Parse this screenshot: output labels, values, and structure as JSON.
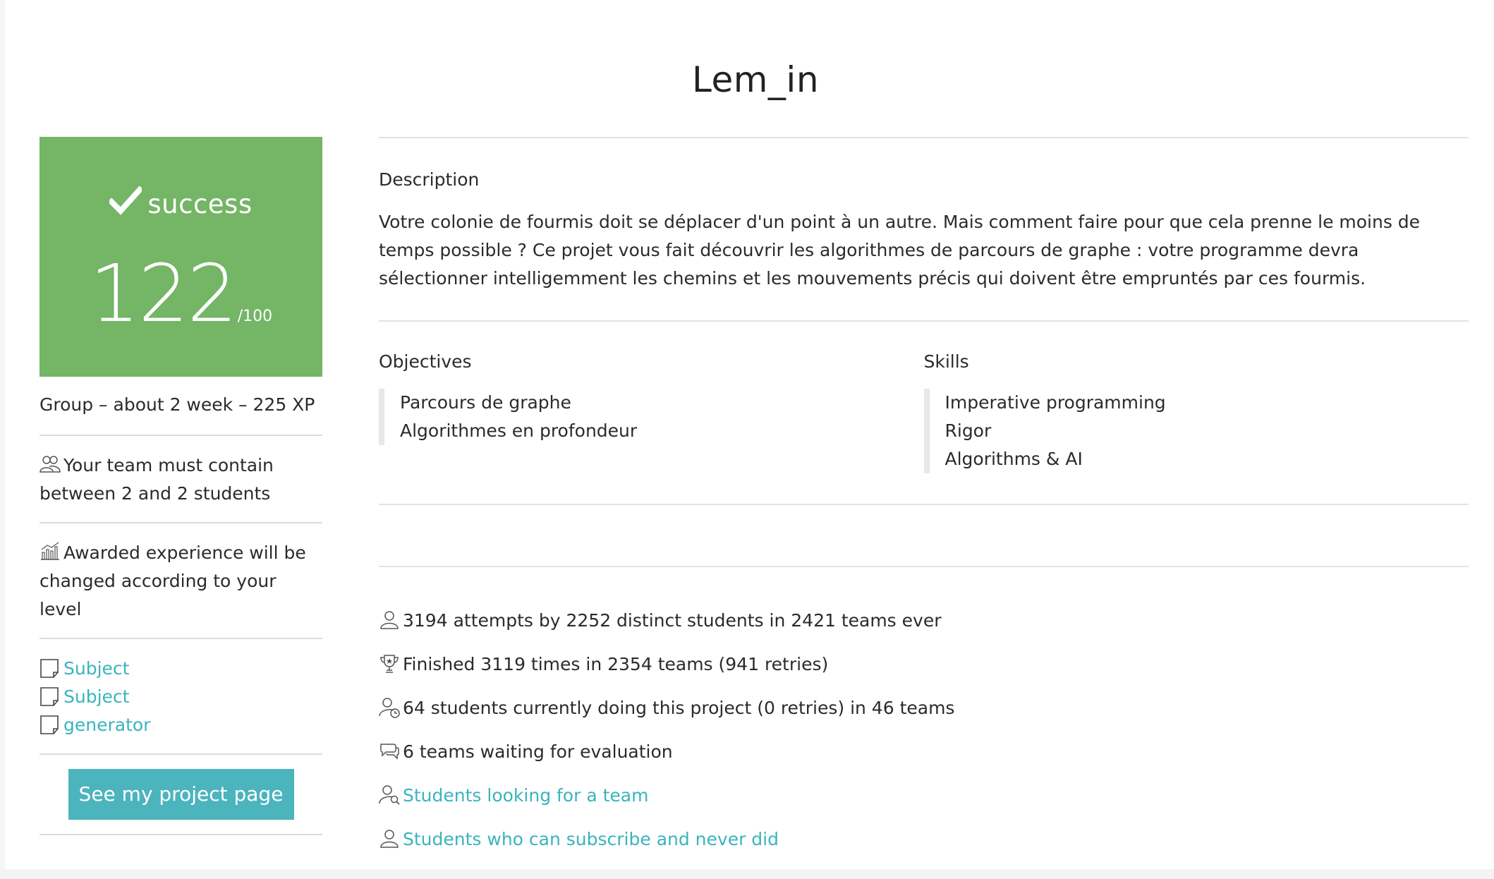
{
  "project": {
    "title": "Lem_in"
  },
  "grade": {
    "status": "success",
    "score": "122",
    "max": "/100",
    "color": "#74b566"
  },
  "sidebar": {
    "meta": "Group – about 2 week – 225 XP",
    "team_note": "Your team must contain between 2 and 2 students",
    "xp_note": "Awarded experience will be changed according to your level",
    "links": [
      {
        "label": "Subject",
        "icon": "document-icon"
      },
      {
        "label": "Subject",
        "icon": "document-icon"
      },
      {
        "label": "generator",
        "icon": "document-icon"
      }
    ],
    "project_button": "See my project page"
  },
  "description": {
    "heading": "Description",
    "text": "Votre colonie de fourmis doit se déplacer d'un point à un autre. Mais comment faire pour que cela prenne le moins de temps possible ? Ce projet vous fait découvrir les algorithmes de parcours de graphe : votre programme devra sélectionner intelligemment les chemins et les mouvements précis qui doivent être empruntés par ces fourmis."
  },
  "objectives": {
    "heading": "Objectives",
    "items": [
      "Parcours de graphe",
      "Algorithmes en profondeur"
    ]
  },
  "skills": {
    "heading": "Skills",
    "items": [
      "Imperative programming",
      "Rigor",
      "Algorithms & AI"
    ]
  },
  "stats": {
    "attempts": "3194 attempts by 2252 distinct students in 2421 teams ever",
    "finished": "Finished 3119 times in 2354 teams (941 retries)",
    "current": "64 students currently doing this project (0 retries) in 46 teams",
    "waiting": "6 teams waiting for evaluation",
    "looking": "Students looking for a team",
    "subscribe": "Students who can subscribe and never did"
  },
  "colors": {
    "accent": "#3ab4bd",
    "button": "#4cb4bd"
  }
}
